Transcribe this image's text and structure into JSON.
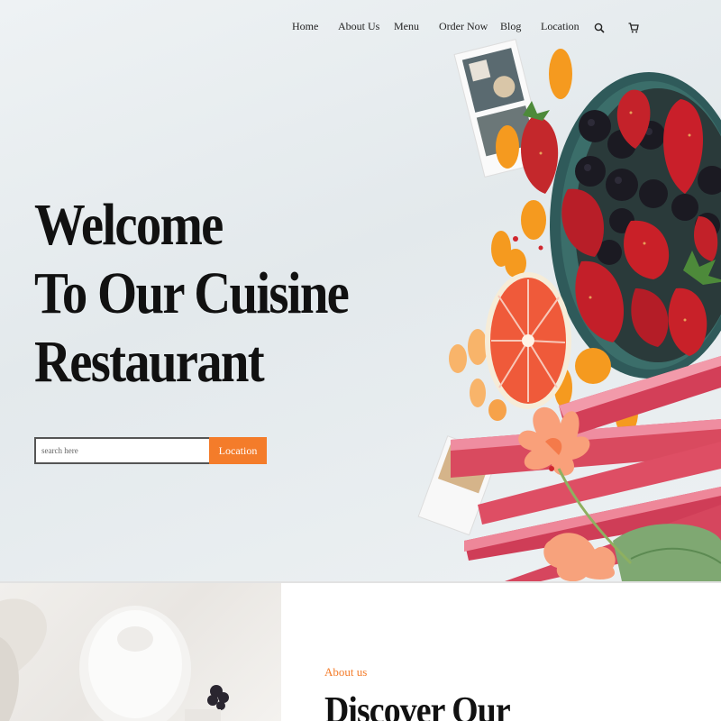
{
  "nav": {
    "items": [
      {
        "label": "Home"
      },
      {
        "label": "About Us"
      },
      {
        "label": "Menu"
      },
      {
        "label": "Order Now"
      },
      {
        "label": "Blog"
      },
      {
        "label": "Location"
      }
    ],
    "icons": [
      "search-icon",
      "cart-icon"
    ]
  },
  "hero": {
    "headline_lines": [
      "Welcome",
      "To Our Cuisine",
      "Restaurant"
    ],
    "search": {
      "placeholder": "search here",
      "value": "",
      "button_label": "Location"
    }
  },
  "about": {
    "eyebrow": "About us",
    "title": "Discover Our"
  },
  "colors": {
    "accent": "#f47c2a",
    "text": "#111111"
  }
}
